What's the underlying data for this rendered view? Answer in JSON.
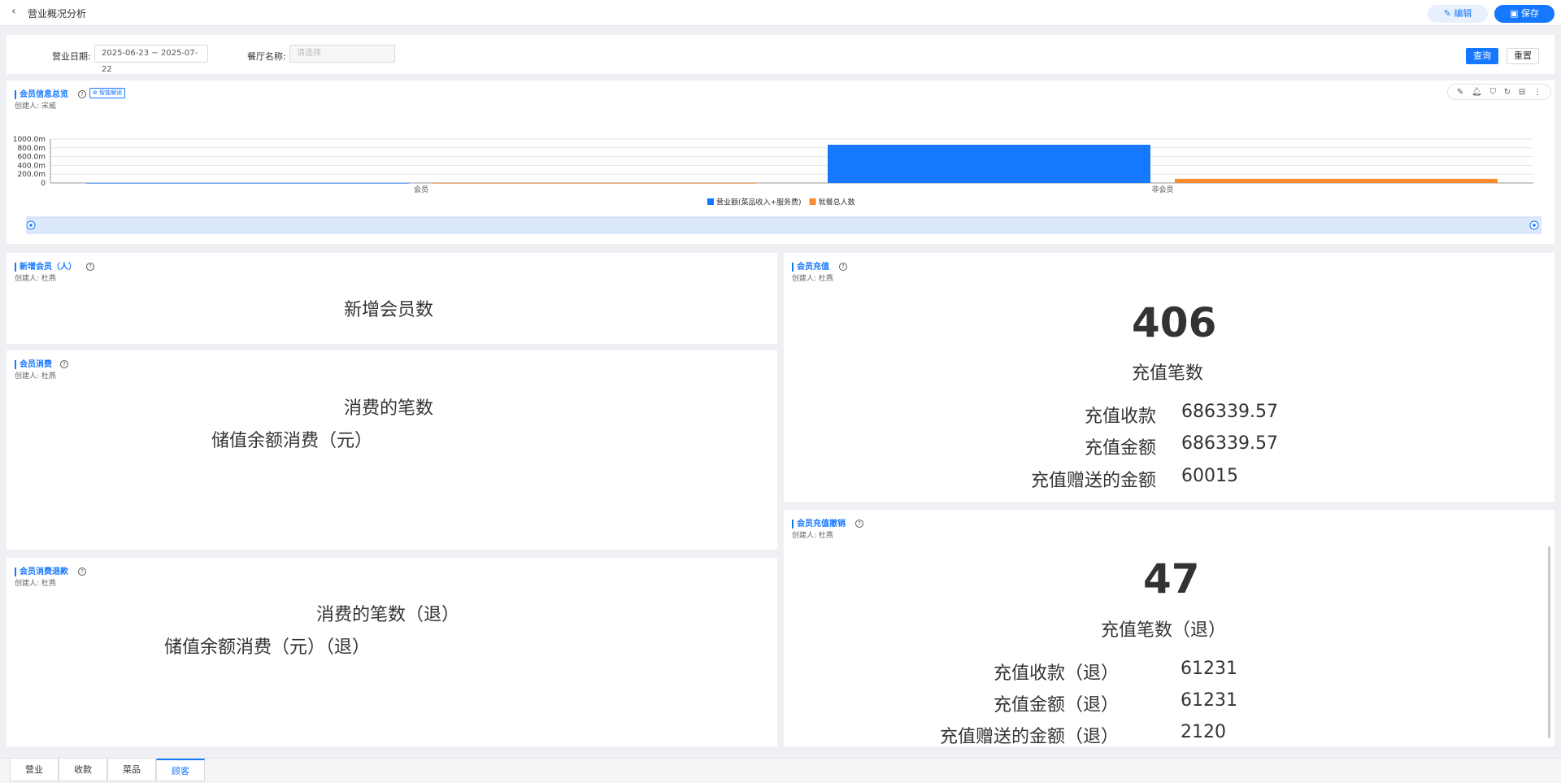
{
  "header": {
    "back_glyph": "‹",
    "title": "营业概况分析",
    "edit_label": "✎ 编辑",
    "save_label": "▣ 保存"
  },
  "filters": {
    "date_label": "营业日期:",
    "date_value": "2025-06-23 ~ 2025-07-22",
    "restaurant_label": "餐厅名称:",
    "restaurant_placeholder": "请选择",
    "query_label": "查询",
    "reset_label": "重置"
  },
  "overview": {
    "title": "会员信息总览",
    "ai_label": "⊕ 智能解读",
    "creator": "创建人: 宋威",
    "toolbox_icons": [
      "edit-icon",
      "bell-icon",
      "filter-icon",
      "refresh-icon",
      "export-icon",
      "more-icon"
    ]
  },
  "chart_data": {
    "type": "bar",
    "categories": [
      "会员",
      "非会员"
    ],
    "series": [
      {
        "name": "营业额(菜品收入+服务费)",
        "values": [
          2,
          870
        ],
        "color": "#1677ff"
      },
      {
        "name": "就餐总人数",
        "values": [
          0,
          95
        ],
        "color": "#fa8c2e"
      }
    ],
    "ylim": [
      0,
      1000
    ],
    "ytick_labels": [
      "0",
      "200.0m",
      "400.0m",
      "600.0m",
      "800.0m",
      "1000.0m"
    ],
    "grid": true,
    "legend": "bottom-center"
  },
  "new_members": {
    "title": "新增会员（人）",
    "creator": "创建人: 杜燕",
    "metric_label": "新增会员数"
  },
  "member_consume": {
    "title": "会员消费",
    "creator": "创建人: 杜燕",
    "count_label": "消费的笔数",
    "amount_label": "储值余额消费（元）"
  },
  "member_refund": {
    "title": "会员消费退款",
    "creator": "创建人: 杜燕",
    "count_label": "消费的笔数（退）",
    "amount_label": "储值余额消费（元）（退）"
  },
  "member_recharge": {
    "title": "会员充值",
    "creator": "创建人: 杜燕",
    "count": "406",
    "count_label": "充值笔数",
    "rows": [
      {
        "label": "充值收款",
        "value": "686339.57"
      },
      {
        "label": "充值金额",
        "value": "686339.57"
      },
      {
        "label": "充值赠送的金额",
        "value": "60015"
      }
    ]
  },
  "recharge_cancel": {
    "title": "会员充值撤销",
    "creator": "创建人: 杜燕",
    "count": "47",
    "count_label": "充值笔数（退）",
    "rows": [
      {
        "label": "充值收款（退）",
        "value": "61231"
      },
      {
        "label": "充值金额（退）",
        "value": "61231"
      },
      {
        "label": "充值赠送的金额（退）",
        "value": "2120"
      }
    ]
  },
  "tabs": [
    {
      "label": "营业",
      "active": false
    },
    {
      "label": "收款",
      "active": false
    },
    {
      "label": "菜品",
      "active": false
    },
    {
      "label": "顾客",
      "active": true
    }
  ]
}
